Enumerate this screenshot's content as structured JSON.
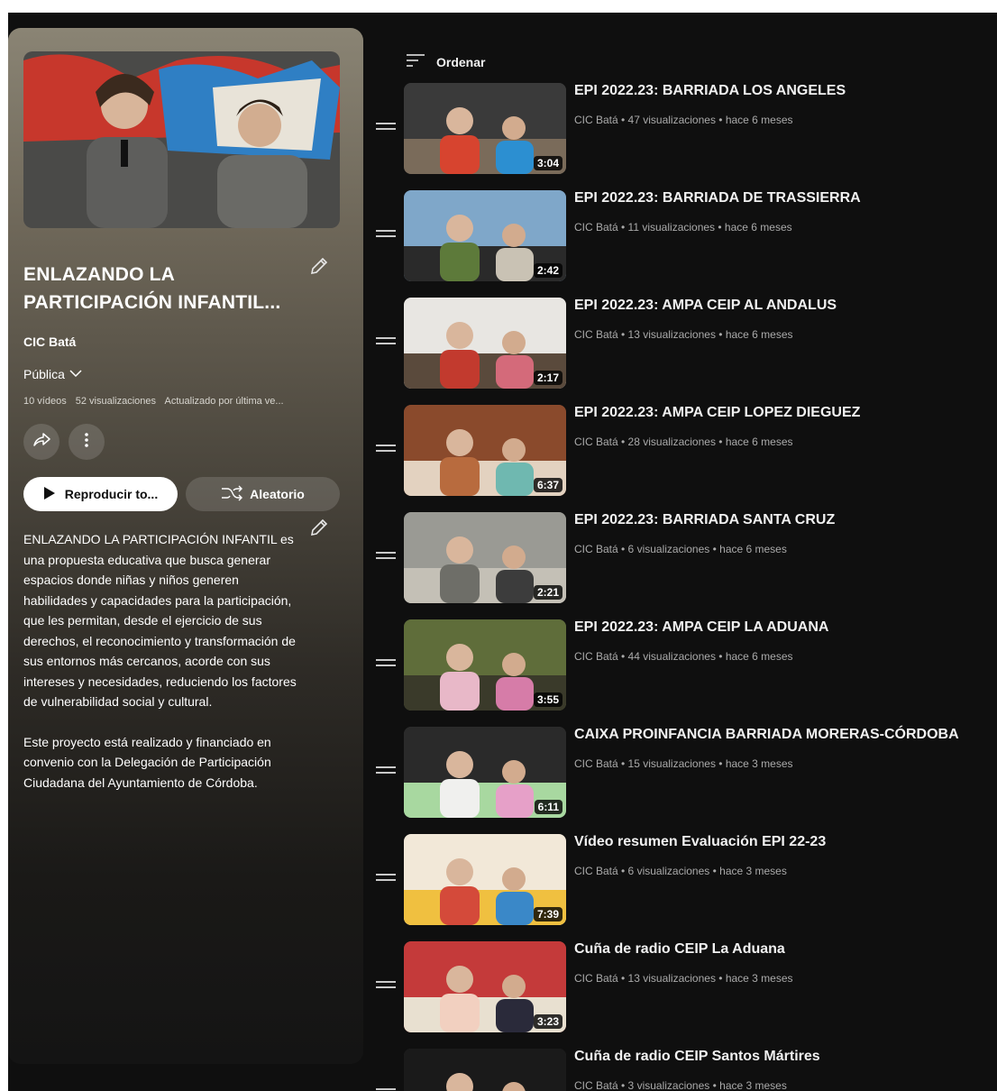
{
  "playlist": {
    "title_line1": "ENLAZANDO LA",
    "title_line2": "PARTICIPACIÓN INFANTIL...",
    "channel": "CIC Batá",
    "privacy": "Pública",
    "stats": {
      "videos": "10 vídeos",
      "views": "52 visualizaciones",
      "updated": "Actualizado por última ve..."
    },
    "play_label": "Reproducir to...",
    "shuffle_label": "Aleatorio",
    "description_p1": "ENLAZANDO LA PARTICIPACIÓN INFANTIL es una propuesta educativa que busca generar espacios donde niñas y niños generen habilidades y capacidades para la participación, que les permitan, desde el ejercicio de sus derechos, el reconocimiento y transformación de sus entornos más cercanos, acorde con sus intereses y necesidades, reduciendo los factores de vulnerabilidad social y cultural.",
    "description_p2": "Este proyecto está realizado y financiado en convenio con la Delegación de Participación Ciudadana del Ayuntamiento de Córdoba."
  },
  "sort_label": "Ordenar",
  "videos": [
    {
      "title": "EPI 2022.23: BARRIADA LOS ANGELES",
      "meta": "CIC Batá • 47 visualizaciones • hace 6 meses",
      "duration": "3:04",
      "colors": [
        "#3a3a3a",
        "#d7442f",
        "#2c8fd1",
        "#7a6b5a"
      ]
    },
    {
      "title": "EPI 2022.23: BARRIADA DE TRASSIERRA",
      "meta": "CIC Batá • 11 visualizaciones • hace 6 meses",
      "duration": "2:42",
      "colors": [
        "#7fa7c9",
        "#5d7a3a",
        "#c9c2b4",
        "#2a2a2a"
      ]
    },
    {
      "title": "EPI 2022.23: AMPA CEIP AL ANDALUS",
      "meta": "CIC Batá • 13 visualizaciones • hace 6 meses",
      "duration": "2:17",
      "colors": [
        "#e8e6e2",
        "#c23a2e",
        "#d46a7a",
        "#5a4a3c"
      ]
    },
    {
      "title": "EPI 2022.23: AMPA CEIP LOPEZ DIEGUEZ",
      "meta": "CIC Batá • 28 visualizaciones • hace 6 meses",
      "duration": "6:37",
      "colors": [
        "#8a4a2c",
        "#b86b3e",
        "#6fb8b0",
        "#e3d2c0"
      ]
    },
    {
      "title": "EPI 2022.23: BARRIADA SANTA CRUZ",
      "meta": "CIC Batá • 6 visualizaciones • hace 6 meses",
      "duration": "2:21",
      "colors": [
        "#9a9a94",
        "#6e6e68",
        "#3c3c3c",
        "#c4c0b6"
      ]
    },
    {
      "title": "EPI 2022.23: AMPA CEIP LA ADUANA",
      "meta": "CIC Batá • 44 visualizaciones • hace 6 meses",
      "duration": "3:55",
      "colors": [
        "#5f6d3a",
        "#e8b8c8",
        "#d67ca8",
        "#3a3a2a"
      ]
    },
    {
      "title": "CAIXA PROINFANCIA BARRIADA MORERAS-CÓRDOBA",
      "meta": "CIC Batá • 15 visualizaciones • hace 3 meses",
      "duration": "6:11",
      "colors": [
        "#2a2a2a",
        "#f0f0ee",
        "#e6a0c8",
        "#a8d8a0"
      ]
    },
    {
      "title": "Vídeo resumen Evaluación EPI 22-23",
      "meta": "CIC Batá • 6 visualizaciones • hace 3 meses",
      "duration": "7:39",
      "colors": [
        "#f2e8d8",
        "#d44a3a",
        "#3a88c8",
        "#f0c040"
      ]
    },
    {
      "title": "Cuña de radio CEIP La Aduana",
      "meta": "CIC Batá • 13 visualizaciones • hace 3 meses",
      "duration": "3:23",
      "colors": [
        "#c43a3a",
        "#f2d0c0",
        "#2a2a3a",
        "#e8e0d0"
      ]
    },
    {
      "title": "Cuña de radio CEIP Santos Mártires",
      "meta": "CIC Batá • 3 visualizaciones • hace 3 meses",
      "duration": "",
      "colors": [
        "#1a1a1a",
        "#8a7a6a",
        "#c8b8a0",
        "#4a4a4a"
      ]
    }
  ]
}
